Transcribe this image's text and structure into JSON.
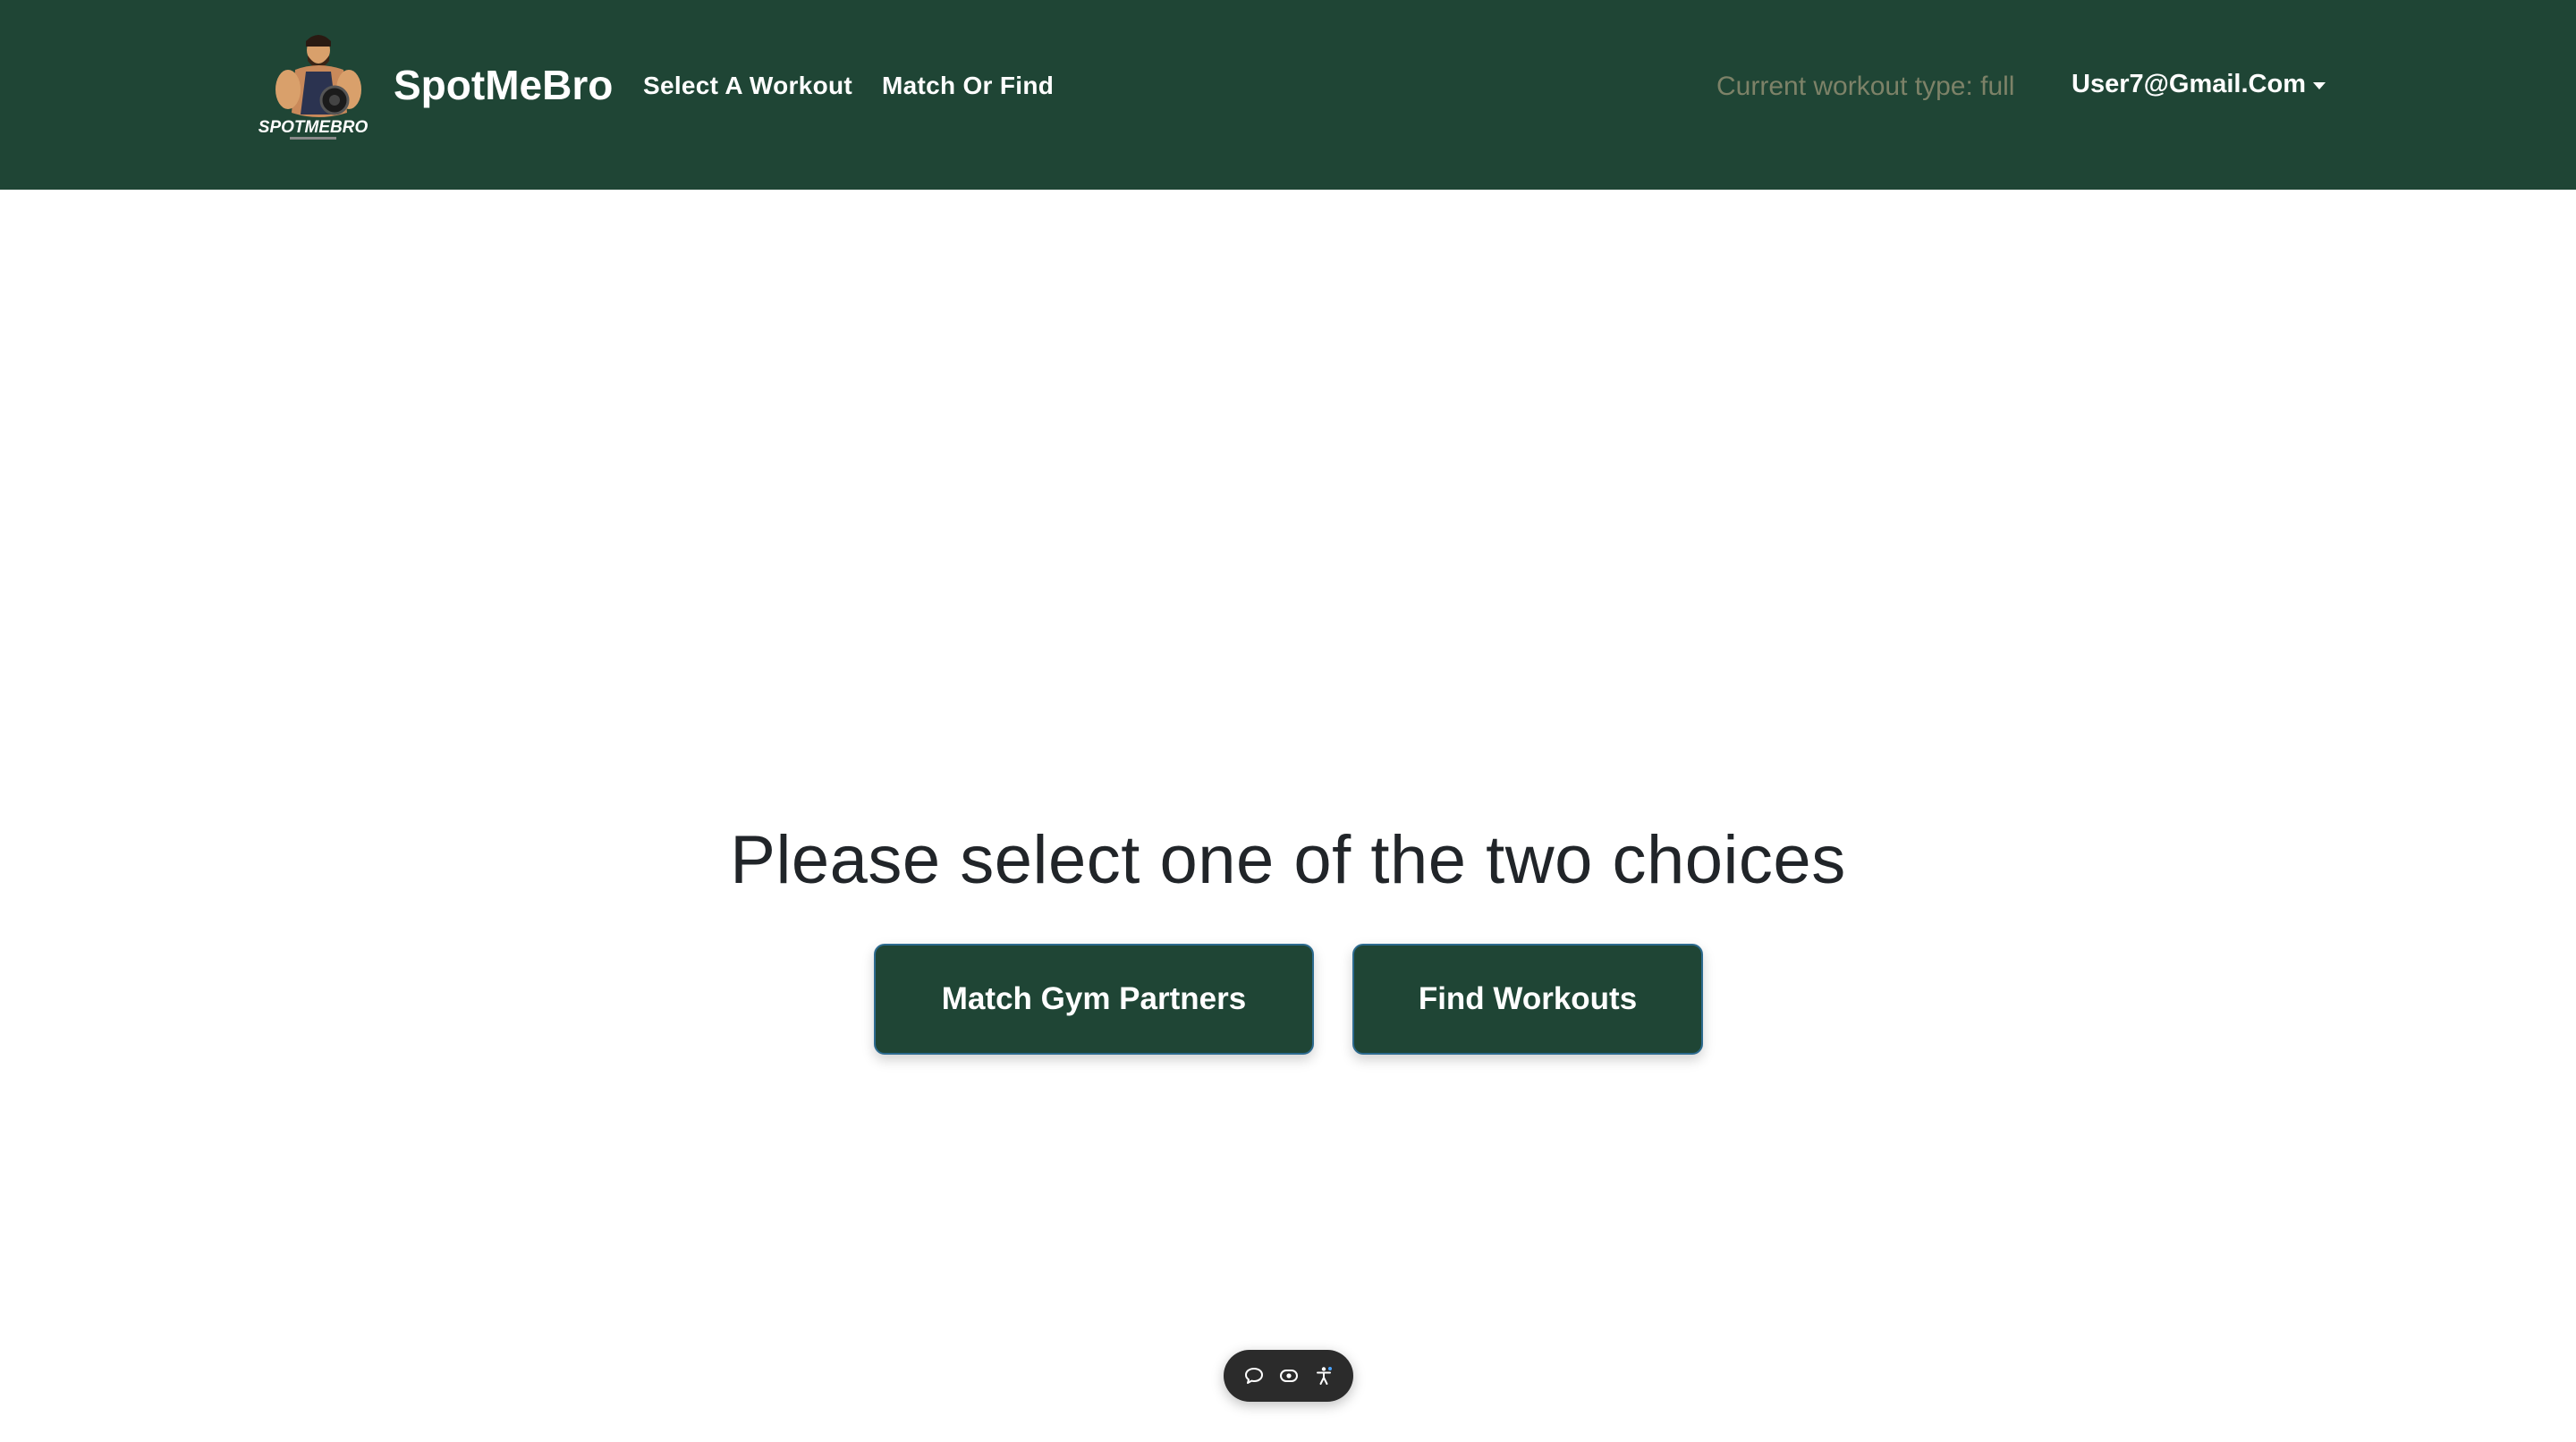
{
  "header": {
    "brand": "SpotMeBro",
    "logo_text": "SPOTMEBRO",
    "nav": {
      "select_workout": "Select A Workout",
      "match_or_find": "Match Or Find"
    },
    "workout_type": "Current workout type: full",
    "user": "User7@Gmail.Com"
  },
  "main": {
    "heading": "Please select one of the two choices",
    "buttons": {
      "match": "Match Gym Partners",
      "find": "Find Workouts"
    }
  },
  "widget": {
    "icons": [
      "chat-bubble-icon",
      "eye-icon",
      "accessibility-icon"
    ]
  },
  "colors": {
    "navbar": "#1f4535",
    "button": "#1f4535",
    "workout_type_text": "#7d8268",
    "heading": "#212529"
  }
}
